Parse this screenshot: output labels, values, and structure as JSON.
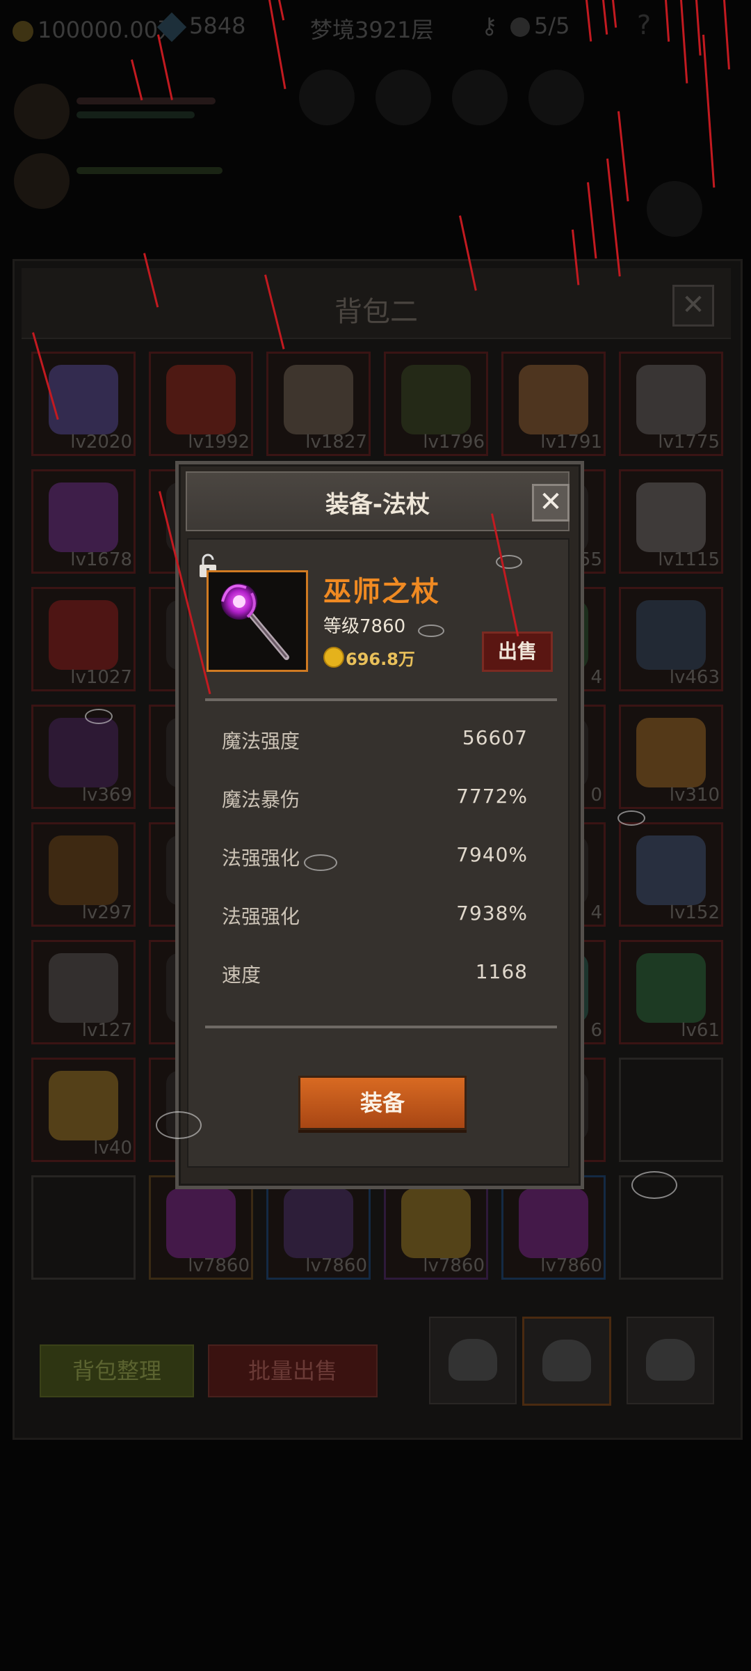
{
  "top_bar": {
    "gold": "100000.00万",
    "gems": "5848",
    "floor": "梦境3921层",
    "skulls": "5/5"
  },
  "bag": {
    "title": "背包二",
    "close_symbol": "✕",
    "cells": [
      {
        "lv": "lv2020",
        "c": "#6a5ec8"
      },
      {
        "lv": "lv1992",
        "c": "#b82c1e"
      },
      {
        "lv": "lv1827",
        "c": "#8a7a66"
      },
      {
        "lv": "lv1796",
        "c": "#3e5a28"
      },
      {
        "lv": "lv1791",
        "c": "#b87a3e"
      },
      {
        "lv": "lv1775",
        "c": "#7a7a7a"
      },
      {
        "lv": "lv1678",
        "c": "#8a3ab8"
      },
      {
        "lv": "",
        "c": "#333"
      },
      {
        "lv": "",
        "c": "#333"
      },
      {
        "lv": "",
        "c": "#333"
      },
      {
        "lv": "55",
        "c": "#333"
      },
      {
        "lv": "lv1115",
        "c": "#8a8a8a"
      },
      {
        "lv": "lv1027",
        "c": "#b82020"
      },
      {
        "lv": "",
        "c": "#333"
      },
      {
        "lv": "",
        "c": "#333"
      },
      {
        "lv": "",
        "c": "#333"
      },
      {
        "lv": "4",
        "c": "#2a6a3a"
      },
      {
        "lv": "lv463",
        "c": "#3a5a7a"
      },
      {
        "lv": "lv369",
        "c": "#5a2a7a"
      },
      {
        "lv": "",
        "c": "#333"
      },
      {
        "lv": "",
        "c": "#333"
      },
      {
        "lv": "",
        "c": "#333"
      },
      {
        "lv": "0",
        "c": "#333"
      },
      {
        "lv": "lv310",
        "c": "#c8862a"
      },
      {
        "lv": "lv297",
        "c": "#8a5a1a"
      },
      {
        "lv": "",
        "c": "#333"
      },
      {
        "lv": "",
        "c": "#333"
      },
      {
        "lv": "",
        "c": "#333"
      },
      {
        "lv": "4",
        "c": "#333"
      },
      {
        "lv": "lv152",
        "c": "#4a6a9a"
      },
      {
        "lv": "lv127",
        "c": "#6a6a6a"
      },
      {
        "lv": "",
        "c": "#333"
      },
      {
        "lv": "",
        "c": "#333"
      },
      {
        "lv": "",
        "c": "#333"
      },
      {
        "lv": "6",
        "c": "#2a7a6a"
      },
      {
        "lv": "lv61",
        "c": "#2a8a4a"
      },
      {
        "lv": "lv40",
        "c": "#c89a2a"
      },
      {
        "lv": "",
        "c": "#333"
      },
      {
        "lv": "",
        "c": "#333"
      },
      {
        "lv": "",
        "c": "#333"
      },
      {
        "lv": "",
        "c": "#333"
      },
      {
        "lv": "",
        "c": "#222",
        "empty": true
      },
      {
        "lv": "",
        "c": "#222",
        "empty": true
      },
      {
        "lv": "lv7860",
        "c": "#9a2ab8",
        "r": "o"
      },
      {
        "lv": "lv7860",
        "c": "#5a3a8a",
        "r": "b"
      },
      {
        "lv": "lv7860",
        "c": "#c8a22a",
        "r": "p"
      },
      {
        "lv": "lv7860",
        "c": "#9a2ab8",
        "r": "b"
      },
      {
        "lv": "",
        "c": "#222",
        "empty": true
      }
    ],
    "sort_button": "背包整理",
    "bulk_sell_button": "批量出售"
  },
  "modal": {
    "title": "装备-法杖",
    "close_symbol": "✕",
    "item": {
      "name": "巫师之杖",
      "level": "等级7860",
      "price": "696.8万",
      "name_color": "#f08a22"
    },
    "sell_button": "出售",
    "stats": [
      {
        "name": "魔法强度",
        "value": "56607"
      },
      {
        "name": "魔法暴伤",
        "value": "7772%"
      },
      {
        "name": "法强强化",
        "value": "7940%"
      },
      {
        "name": "法强强化",
        "value": "7938%"
      },
      {
        "name": "速度",
        "value": "1168"
      }
    ],
    "equip_button": "装备"
  },
  "icons": {
    "lock": "unlocked-padlock-icon",
    "gold": "gold-coin-icon",
    "item": "staff-icon",
    "bag_tabs": "backpack-icon"
  }
}
